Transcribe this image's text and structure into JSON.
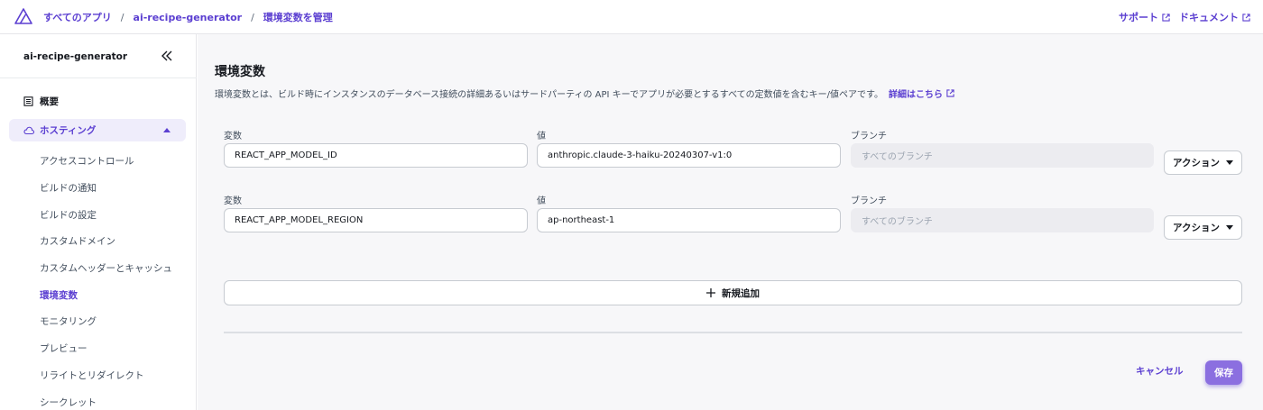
{
  "breadcrumb": [
    "すべてのアプリ",
    "ai-recipe-generator",
    "環境変数を管理"
  ],
  "header": {
    "support": "サポート",
    "docs": "ドキュメント"
  },
  "sidebar": {
    "app_name": "ai-recipe-generator",
    "overview": "概要",
    "hosting": "ホスティング",
    "items": [
      "アクセスコントロール",
      "ビルドの通知",
      "ビルドの設定",
      "カスタムドメイン",
      "カスタムヘッダーとキャッシュ",
      "環境変数",
      "モニタリング",
      "プレビュー",
      "リライトとリダイレクト",
      "シークレット"
    ],
    "active": "環境変数"
  },
  "main": {
    "title": "環境変数",
    "description": "環境変数とは、ビルド時にインスタンスのデータベース接続の詳細あるいはサードパーティの API キーでアプリが必要とするすべての定数値を含むキー/値ペアです。",
    "learn_more": "詳細はこちら",
    "labels": {
      "variable": "変数",
      "value": "値",
      "branch": "ブランチ"
    },
    "rows": [
      {
        "key": "REACT_APP_MODEL_ID",
        "value": "anthropic.claude-3-haiku-20240307-v1:0",
        "branch_placeholder": "すべてのブランチ",
        "action": "アクション"
      },
      {
        "key": "REACT_APP_MODEL_REGION",
        "value": "ap-northeast-1",
        "branch_placeholder": "すべてのブランチ",
        "action": "アクション"
      }
    ],
    "add_new": "新規追加",
    "cancel": "キャンセル",
    "save": "保存"
  },
  "colors": {
    "accent": "#5b3fd1",
    "save_button": "#8b6fe0",
    "hosting_bg": "#efedfb"
  }
}
